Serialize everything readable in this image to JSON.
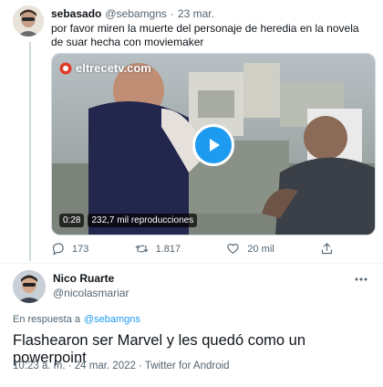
{
  "tweet1": {
    "display_name": "sebasado",
    "handle": "@sebamgns",
    "separator": "·",
    "date": "23 mar.",
    "text": "por favor miren la muerte del personaje de heredia en la novela de suar hecha con moviemaker",
    "video": {
      "watermark": "eltrecetv.com",
      "duration": "0:28",
      "views": "232,7 mil reproducciones"
    },
    "actions": {
      "replies": "173",
      "retweets": "1.817",
      "likes": "20 mil"
    }
  },
  "tweet2": {
    "display_name": "Nico Ruarte",
    "handle": "@nicolasmariar",
    "reply_prefix": "En respuesta a",
    "reply_to": "@sebamgns",
    "text": "Flashearon ser Marvel y les quedó como un powerpoint",
    "meta": "10:23 a. m. · 24 mar. 2022 · Twitter for Android"
  },
  "colors": {
    "accent": "#1d9bf0",
    "muted": "#536471",
    "play": "#1d9bf0"
  }
}
